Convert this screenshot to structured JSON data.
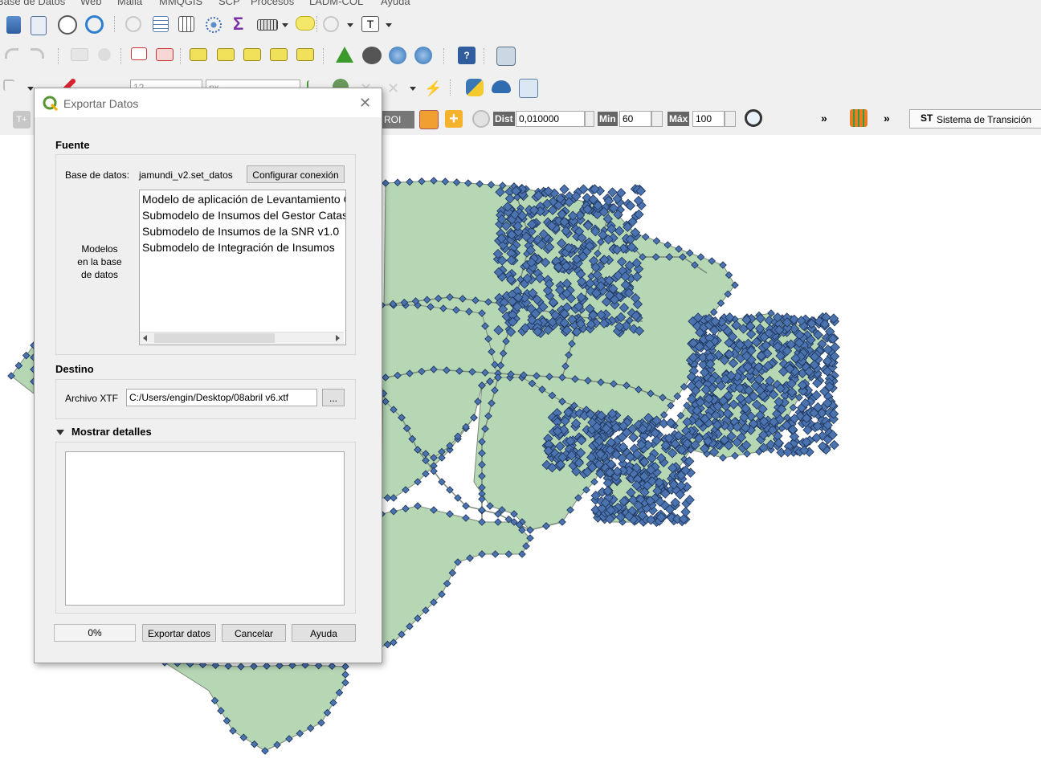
{
  "menubar": [
    "Base de Datos",
    "Web",
    "Malla",
    "MMQGIS",
    "SCP",
    "Procesos",
    "LADM-COL",
    "Ayuda"
  ],
  "digitize_toolbar": {
    "font_size": "12",
    "unit": "px"
  },
  "scp_toolbar": {
    "roi_label": "ROI",
    "dist_label": "Dist",
    "dist_value": "0,010000",
    "min_label": "Min",
    "min_value": "60",
    "max_label": "Máx",
    "max_value": "100",
    "more1": "»",
    "more2": "»",
    "st_badge": "ST",
    "st_label": "Sistema de Transición"
  },
  "dialog": {
    "title": "Exportar Datos",
    "close_glyph": "✕",
    "fuente_title": "Fuente",
    "db_label": "Base de datos:",
    "db_value": "jamundi_v2.set_datos",
    "config_button": "Configurar conexión",
    "models_label": "Modelos en la base de datos",
    "models": [
      "Modelo de aplicación de Levantamiento Catastral",
      "Submodelo de Insumos del Gestor Catastral",
      "Submodelo de Insumos de la SNR v1.0",
      "Submodelo de Integración de Insumos"
    ],
    "destino_title": "Destino",
    "xtf_label": "Archivo XTF",
    "xtf_value": "C:/Users/engin/Desktop/08abril v6.xtf",
    "browse_button": "...",
    "details_title": "Mostrar detalles",
    "progress": "0%",
    "export_button": "Exportar datos",
    "cancel_button": "Cancelar",
    "help_button": "Ayuda"
  },
  "colors": {
    "polygon_fill": "#b6d7b4",
    "polygon_edge": "#7a8a7a",
    "vertex_fill": "#4a73b0",
    "vertex_edge": "#1d3357",
    "toolbar_bg": "#f0f0f0"
  }
}
